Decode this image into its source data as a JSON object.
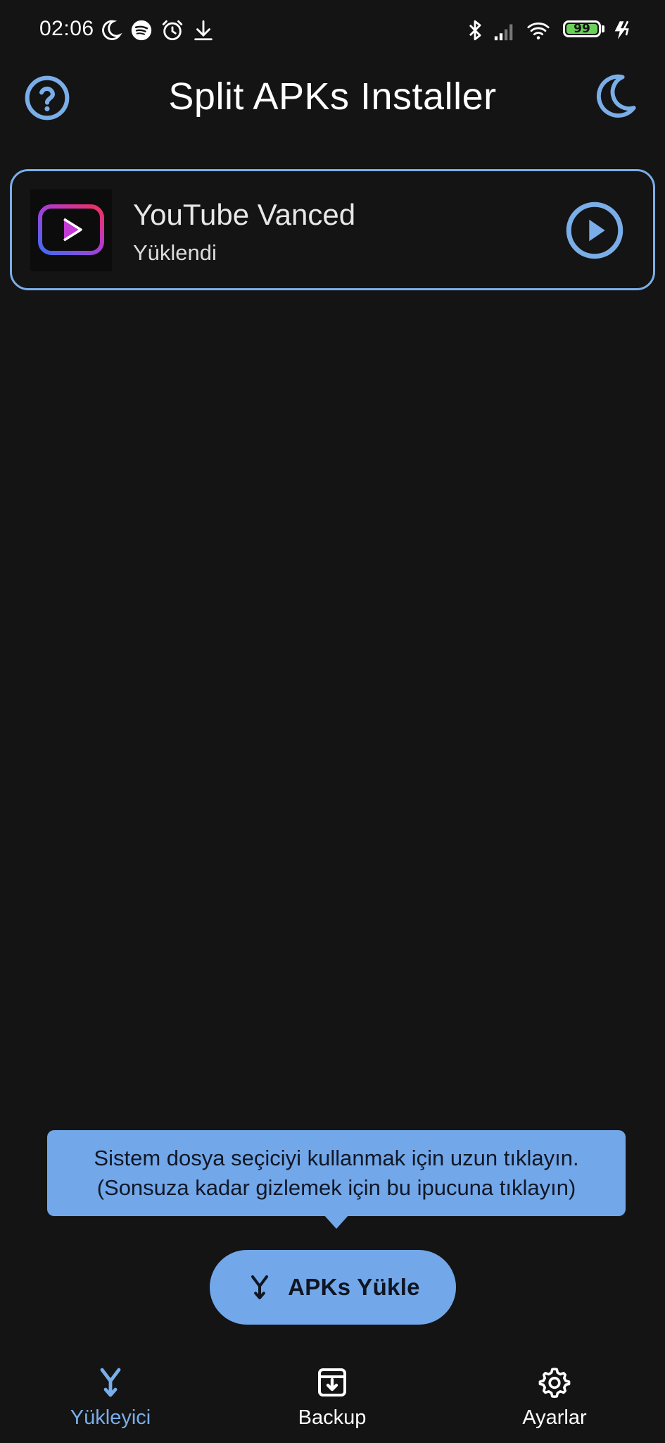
{
  "status_bar": {
    "time": "02:06",
    "left_icons": [
      "moon-icon",
      "spotify-icon",
      "alarm-icon",
      "download-icon"
    ],
    "right_icons": [
      "bluetooth-icon",
      "signal-icon",
      "wifi-icon",
      "battery-icon",
      "charging-icon"
    ],
    "battery_level": "99",
    "battery_color": "#6ad05a"
  },
  "app_bar": {
    "title": "Split APKs Installer",
    "left_icon": "help-circle-icon",
    "right_icon": "crescent-moon-icon"
  },
  "installed_apps": [
    {
      "name": "YouTube Vanced",
      "status": "Yüklendi",
      "icon": "youtube-vanced-icon",
      "action_icon": "play-circle-icon"
    }
  ],
  "tooltip": {
    "line1": "Sistem dosya seçiciyi kullanmak için uzun tıklayın.",
    "line2": "(Sonsuza kadar gizlemek için bu ipucuna tıklayın)"
  },
  "fab": {
    "label": "APKs Yükle",
    "icon": "merge-arrow-icon"
  },
  "bottom_nav": [
    {
      "label": "Yükleyici",
      "icon": "merge-arrow-icon",
      "active": true
    },
    {
      "label": "Backup",
      "icon": "archive-icon",
      "active": false
    },
    {
      "label": "Ayarlar",
      "icon": "gear-icon",
      "active": false
    }
  ],
  "colors": {
    "background": "#141414",
    "accent": "#7aaee8",
    "tooltip_bg": "#72a7ea"
  }
}
